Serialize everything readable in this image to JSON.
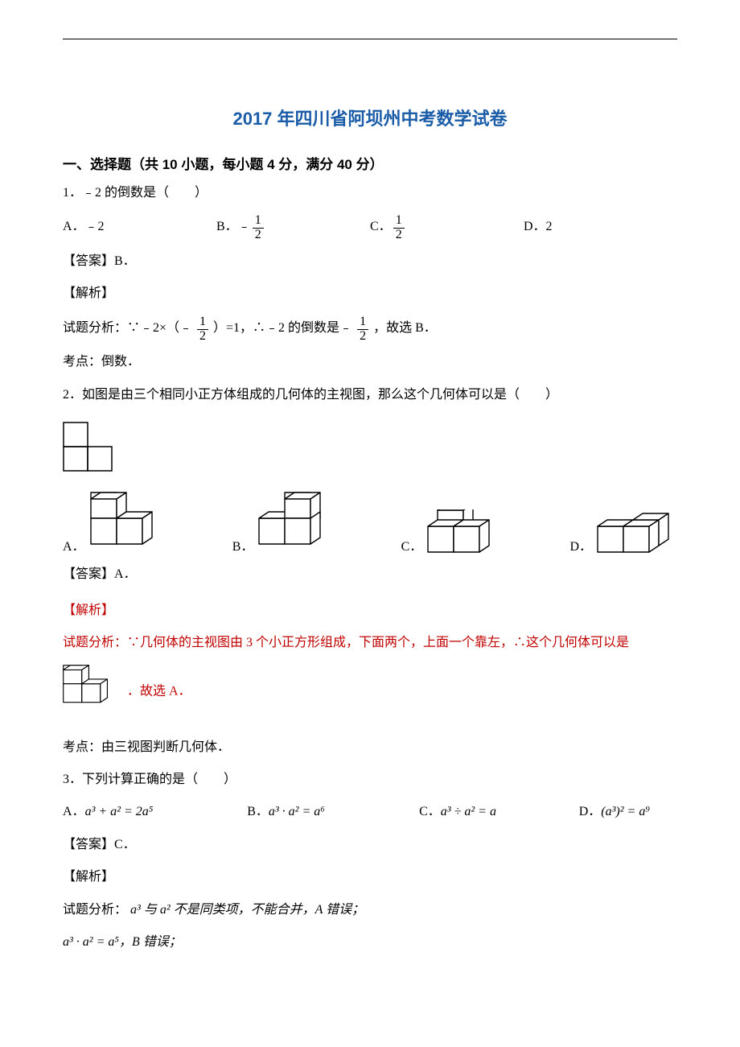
{
  "title": "2017 年四川省阿坝州中考数学试卷",
  "section1_heading": "一、选择题（共 10 小题，每小题 4 分，满分 40 分）",
  "q1": {
    "stem": "1．﹣2 的倒数是（　　）",
    "opts": {
      "A": "A．﹣2",
      "B_prefix": "B．﹣",
      "C_prefix": "C．",
      "D": "D．2"
    },
    "frac_half": {
      "num": "1",
      "den": "2"
    },
    "answer": "【答案】B．",
    "analysis_label": "【解析】",
    "analysis_pre": "试题分析：∵﹣2×（﹣",
    "analysis_mid": "）=1，∴﹣2 的倒数是﹣",
    "analysis_post": "，故选 B．",
    "topic": "考点：倒数．"
  },
  "q2": {
    "stem": "2．如图是由三个相同小正方体组成的几何体的主视图，那么这个几何体可以是（　　）",
    "opts": {
      "A": "A．",
      "B": "B．",
      "C": "C．",
      "D": "D．"
    },
    "answer": "【答案】A．",
    "analysis_label": "【解析】",
    "analysis_text": "试题分析：∵几何体的主视图由 3 个小正方形组成，下面两个，上面一个靠左，∴这个几何体可以是",
    "analysis_tail": "．故选 A．",
    "topic": "考点：由三视图判断几何体．"
  },
  "q3": {
    "stem": "3．下列计算正确的是（　　）",
    "opts": {
      "A_pre": "A．",
      "A_expr": "a³ + a² = 2a⁵",
      "B_pre": "B．",
      "B_expr": "a³ · a² = a⁶",
      "C_pre": "C．",
      "C_expr": "a³ ÷ a² = a",
      "D_pre": "D．",
      "D_expr": "(a³)² = a⁹"
    },
    "answer": "【答案】C．",
    "analysis_label": "【解析】",
    "analysis_l1_pre": "试题分析：",
    "analysis_l1_expr": "a³ 与 a² 不是同类项，不能合并，A 错误；",
    "analysis_l2": "a³ · a² = a⁵，B 错误；"
  }
}
